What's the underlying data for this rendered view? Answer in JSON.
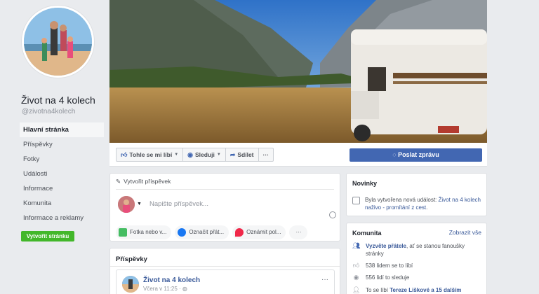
{
  "page": {
    "name": "Život na 4 kolech",
    "handle": "@zivotna4kolech"
  },
  "sidebar": {
    "items": [
      {
        "label": "Hlavní stránka",
        "active": true
      },
      {
        "label": "Příspěvky"
      },
      {
        "label": "Fotky"
      },
      {
        "label": "Události"
      },
      {
        "label": "Informace"
      },
      {
        "label": "Komunita"
      },
      {
        "label": "Informace a reklamy"
      }
    ],
    "create_page_label": "Vytvořit stránku"
  },
  "actions": {
    "like_label": "Tohle se mi líbí",
    "follow_label": "Sleduji",
    "share_label": "Sdílet",
    "more_label": "···",
    "send_message_label": "Poslat zprávu"
  },
  "composer": {
    "title": "Vytvořit příspěvek",
    "placeholder": "Napište příspěvek...",
    "pills": [
      {
        "label": "Fotka nebo v...",
        "color": "#45bd62"
      },
      {
        "label": "Označit přát...",
        "color": "#1877f2"
      },
      {
        "label": "Oznámit pol...",
        "color": "#f02849"
      }
    ],
    "more_label": "···"
  },
  "posts": {
    "title": "Příspěvky",
    "first": {
      "author": "Život na 4 kolech",
      "time": "Včera v 11:25 · "
    }
  },
  "news": {
    "title": "Novinky",
    "text_prefix": "Byla vytvořena nová událost: ",
    "event_link": "Život na 4 kolech naživo - promítání z cest",
    "text_suffix": "."
  },
  "community": {
    "title": "Komunita",
    "show_all": "Zobrazit vše",
    "invite_link": "Vyzvěte přátele",
    "invite_suffix": ", ať se stanou fanoušky stránky",
    "likes": "538 lidem se to líbí",
    "follows": "556 lidí to sleduje",
    "friends_prefix": "To se líbí ",
    "friends_link": "Tereze Liškové a 15 dalším"
  },
  "colors": {
    "brand": "#4267b2",
    "link": "#385898",
    "create_button": "#42b72a",
    "background": "#e9ebee"
  }
}
